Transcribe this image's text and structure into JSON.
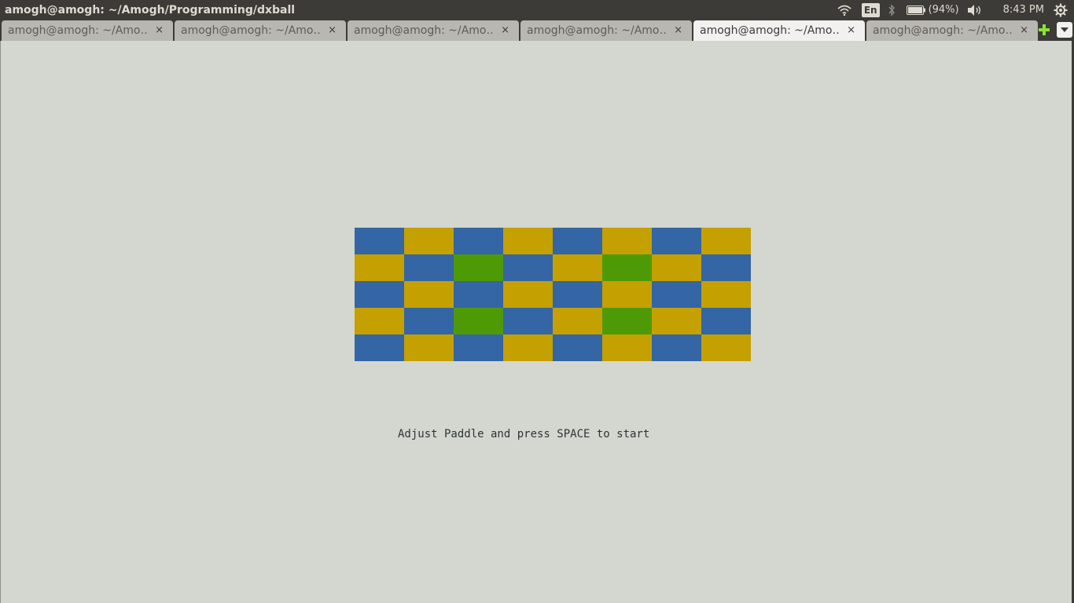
{
  "window": {
    "title": "amogh@amogh: ~/Amogh/Programming/dxball"
  },
  "panel": {
    "language": "En",
    "battery": "(94%)",
    "clock": "8:43 PM",
    "icons": [
      "wifi-icon",
      "bluetooth-icon",
      "battery-icon",
      "volume-icon",
      "gear-icon"
    ]
  },
  "tabs": [
    {
      "label": "amogh@amogh: ~/Amo…",
      "close": "×",
      "active": false
    },
    {
      "label": "amogh@amogh: ~/Amo…",
      "close": "×",
      "active": false
    },
    {
      "label": "amogh@amogh: ~/Amo…",
      "close": "×",
      "active": false
    },
    {
      "label": "amogh@amogh: ~/Amo…",
      "close": "×",
      "active": false
    },
    {
      "label": "amogh@amogh: ~/Amo…",
      "close": "×",
      "active": true
    },
    {
      "label": "amogh@amogh: ~/Amo…",
      "close": "×",
      "active": false
    }
  ],
  "game": {
    "message": "Adjust Paddle and press SPACE to start",
    "colors": {
      "blue": "#3465a4",
      "yellow": "#c4a000",
      "green": "#4e9a06",
      "background": "#d3d7cf"
    },
    "bricks": [
      [
        "blue",
        "yellow",
        "blue",
        "yellow",
        "blue",
        "yellow",
        "blue",
        "yellow"
      ],
      [
        "yellow",
        "blue",
        "green",
        "blue",
        "yellow",
        "green",
        "yellow",
        "blue"
      ],
      [
        "blue",
        "yellow",
        "blue",
        "yellow",
        "blue",
        "yellow",
        "blue",
        "yellow"
      ],
      [
        "yellow",
        "blue",
        "green",
        "blue",
        "yellow",
        "green",
        "yellow",
        "blue"
      ],
      [
        "blue",
        "yellow",
        "blue",
        "yellow",
        "blue",
        "yellow",
        "blue",
        "yellow"
      ]
    ]
  }
}
